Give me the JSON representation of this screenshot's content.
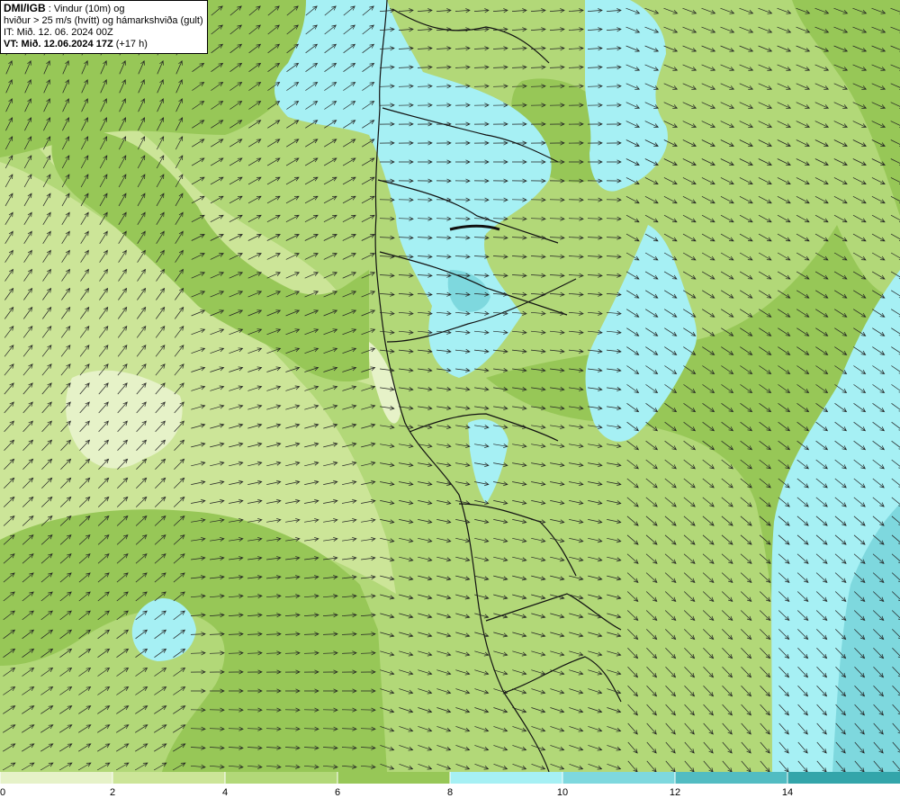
{
  "header": {
    "source": "DMI/IGB",
    "line1_rest": " : Vindur (10m) og",
    "line2": "hviður > 25 m/s (hvítt) og hámarkshviða (gult)",
    "line3": "IT: Mið. 12. 06. 2024 00Z",
    "line4_label": "VT: Mið. 12.06.2024 17Z",
    "line4_rest": " (+17 h)"
  },
  "legend": {
    "ticks": [
      "0",
      "2",
      "4",
      "6",
      "8",
      "10",
      "12",
      "14"
    ],
    "colors": [
      "#e6f2c8",
      "#cce598",
      "#b2d878",
      "#97c757",
      "#a6f0f4",
      "#7ed8de",
      "#52bcc2",
      "#33a5aa"
    ]
  },
  "map_colors": {
    "band_0_2": "#e6f2c8",
    "band_2_4": "#cce598",
    "band_4_6": "#b2d878",
    "band_6_8": "#97c757",
    "band_8_10": "#a6f0f4",
    "band_10_12": "#7ed8de",
    "band_12_14": "#52bcc2",
    "coastline": "#111111",
    "arrows": "#222222"
  }
}
